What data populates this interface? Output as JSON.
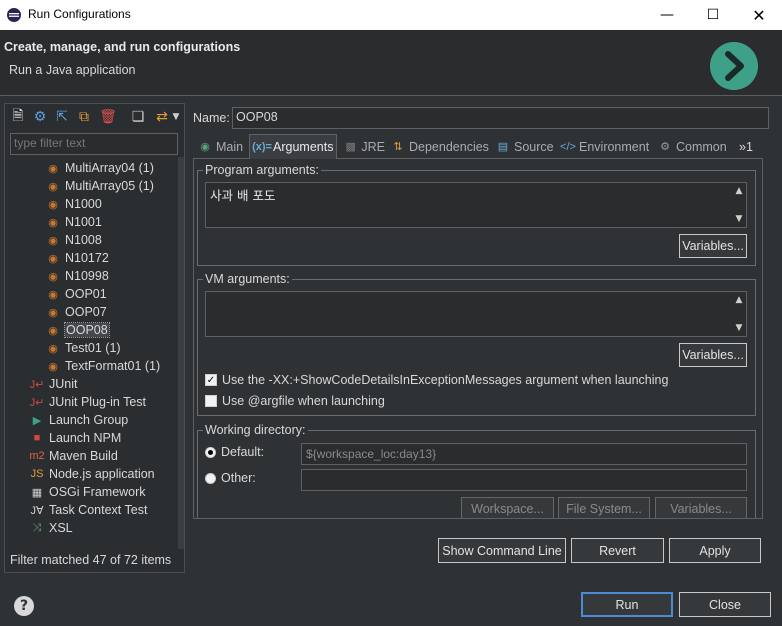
{
  "window": {
    "title": "Run Configurations"
  },
  "banner": {
    "title": "Create, manage, and run configurations",
    "subtitle": "Run a Java application"
  },
  "left": {
    "filter_placeholder": "type filter text",
    "tree": [
      {
        "label": "MultiArray04 (1)",
        "icon": "java-class-icon",
        "indent": 2
      },
      {
        "label": "MultiArray05 (1)",
        "icon": "java-class-icon",
        "indent": 2
      },
      {
        "label": "N1000",
        "icon": "java-class-icon",
        "indent": 2
      },
      {
        "label": "N1001",
        "icon": "java-class-icon",
        "indent": 2
      },
      {
        "label": "N1008",
        "icon": "java-class-icon",
        "indent": 2
      },
      {
        "label": "N10172",
        "icon": "java-class-icon",
        "indent": 2
      },
      {
        "label": "N10998",
        "icon": "java-class-icon",
        "indent": 2
      },
      {
        "label": "OOP01",
        "icon": "java-class-icon",
        "indent": 2
      },
      {
        "label": "OOP07",
        "icon": "java-class-icon",
        "indent": 2
      },
      {
        "label": "OOP08",
        "icon": "java-class-icon",
        "indent": 2,
        "selected": true
      },
      {
        "label": "Test01 (1)",
        "icon": "java-class-icon",
        "indent": 2
      },
      {
        "label": "TextFormat01 (1)",
        "icon": "java-class-icon",
        "indent": 2
      },
      {
        "label": "JUnit",
        "icon": "junit-icon",
        "indent": 1
      },
      {
        "label": "JUnit Plug-in Test",
        "icon": "junit-plugin-icon",
        "indent": 1
      },
      {
        "label": "Launch Group",
        "icon": "launch-group-icon",
        "indent": 1
      },
      {
        "label": "Launch NPM",
        "icon": "npm-icon",
        "indent": 1
      },
      {
        "label": "Maven Build",
        "icon": "maven-icon",
        "indent": 1
      },
      {
        "label": "Node.js application",
        "icon": "nodejs-icon",
        "indent": 1
      },
      {
        "label": "OSGi Framework",
        "icon": "osgi-icon",
        "indent": 1
      },
      {
        "label": "Task Context Test",
        "icon": "task-context-icon",
        "indent": 1
      },
      {
        "label": "XSL",
        "icon": "xsl-icon",
        "indent": 1
      }
    ],
    "status": "Filter matched 47 of 72 items"
  },
  "right": {
    "name_label": "Name:",
    "name_value": "OOP08",
    "tabs": [
      "Main",
      "Arguments",
      "JRE",
      "Dependencies",
      "Source",
      "Environment",
      "Common",
      "»1"
    ],
    "active_tab": "Arguments",
    "program_args": {
      "label": "Program arguments:",
      "value": "사과 배 포도",
      "variables": "Variables..."
    },
    "vm_args": {
      "label": "VM arguments:",
      "value": "",
      "variables": "Variables..."
    },
    "check_showcode": {
      "label": "Use the -XX:+ShowCodeDetailsInExceptionMessages argument when launching",
      "checked": true
    },
    "check_argfile": {
      "label": "Use @argfile when launching",
      "checked": false
    },
    "working_dir": {
      "label": "Working directory:",
      "default_label": "Default:",
      "default_value": "${workspace_loc:day13}",
      "other_label": "Other:",
      "other_value": "",
      "workspace_btn": "Workspace...",
      "filesystem_btn": "File System...",
      "variables_btn": "Variables..."
    },
    "show_cmd": "Show Command Line",
    "revert": "Revert",
    "apply": "Apply"
  },
  "footer": {
    "run": "Run",
    "close": "Close"
  },
  "colors": {
    "accent": "#3fa08a",
    "focus": "#4a8ad6",
    "java_icon": "#c9772e"
  }
}
